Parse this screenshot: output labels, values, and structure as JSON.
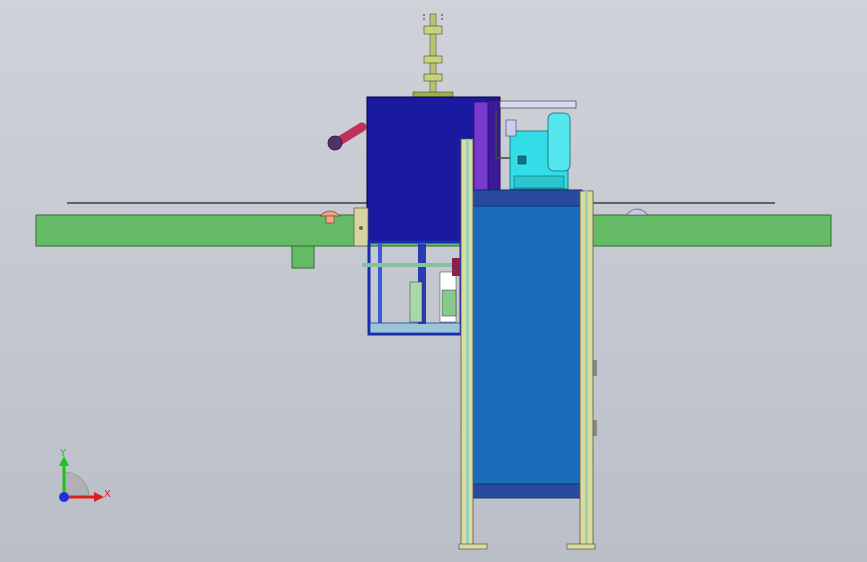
{
  "viewport": {
    "background_top": "#c9ccd4",
    "background_bottom": "#bcc0c8"
  },
  "triad": {
    "x_label": "X",
    "y_label": "Y",
    "x_color": "#e02020",
    "y_color": "#20c020",
    "z_color": "#2030e0"
  },
  "colors": {
    "rail_green": "#66bb66",
    "body_blue": "#1a1aa0",
    "cabinet_blue": "#1a6bb8",
    "frame_yellow": "#dcdc9a",
    "cyan_part": "#33dde8",
    "purple_part": "#7a3ad0",
    "handle_red": "#c0305a",
    "stop_orange": "#f2a585",
    "stop_gray": "#b8b8d8"
  }
}
